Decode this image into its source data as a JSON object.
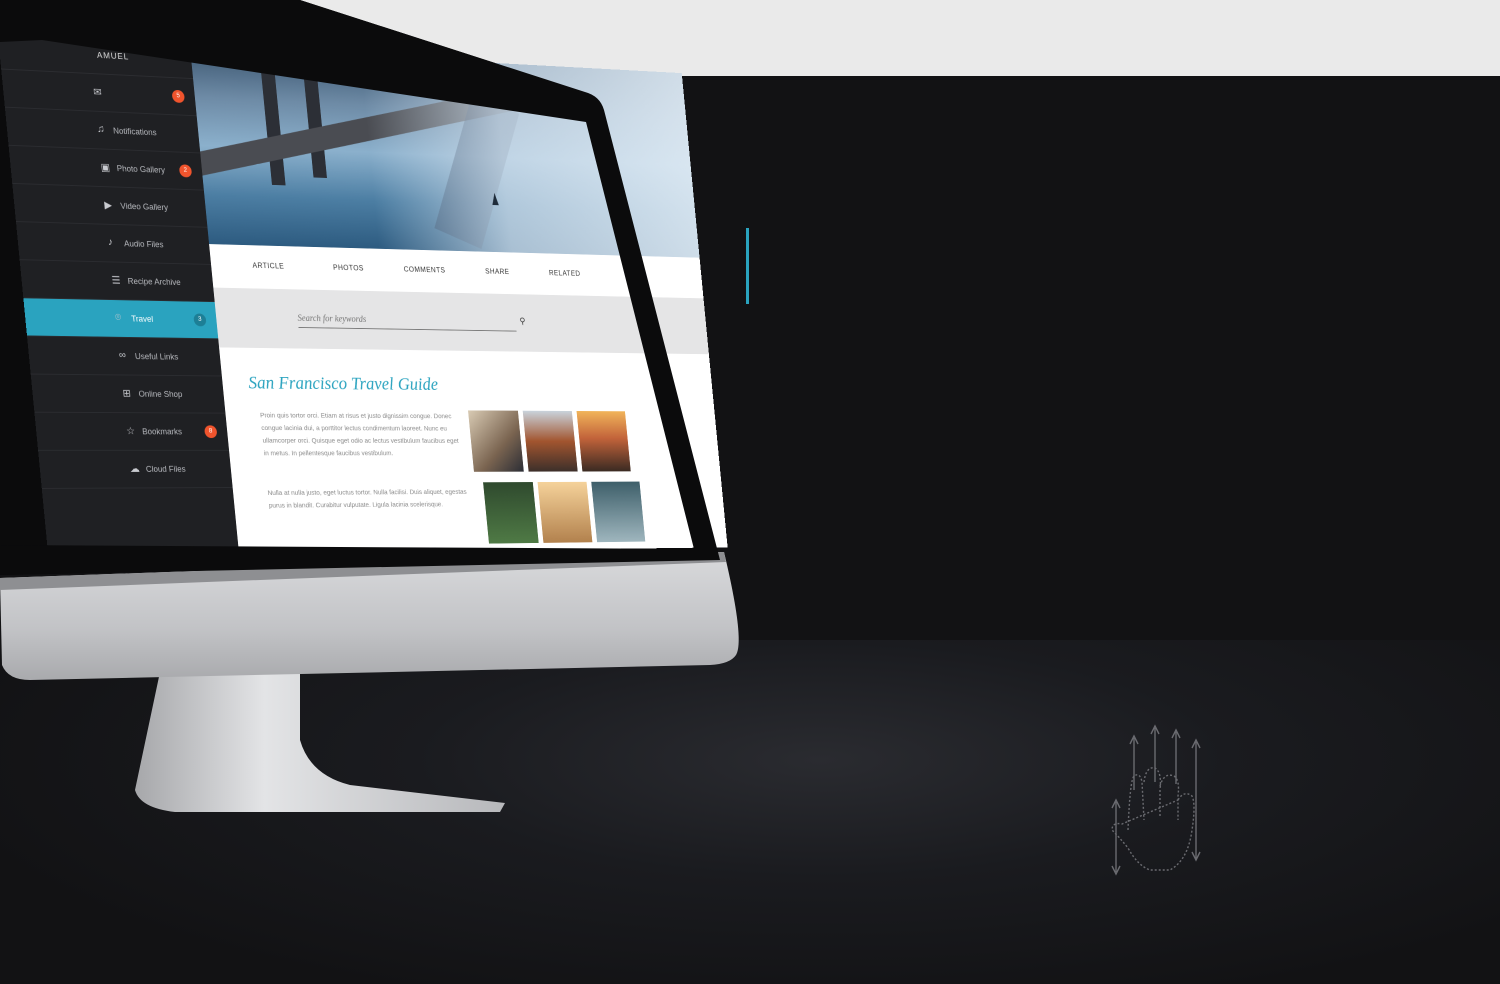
{
  "sidebar": {
    "user": "AMUEL",
    "items": [
      {
        "label": "",
        "icon": "inbox-icon",
        "badge": "5"
      },
      {
        "label": "Notifications",
        "icon": "bell-icon",
        "badge": ""
      },
      {
        "label": "Photo Gallery",
        "icon": "image-icon",
        "badge": "2"
      },
      {
        "label": "Video Gallery",
        "icon": "video-icon",
        "badge": ""
      },
      {
        "label": "Audio Files",
        "icon": "music-icon",
        "badge": ""
      },
      {
        "label": "Recipe Archive",
        "icon": "recipe-icon",
        "badge": ""
      },
      {
        "label": "Travel",
        "icon": "map-pin-icon",
        "badge": "3",
        "active": true
      },
      {
        "label": "Useful Links",
        "icon": "link-icon",
        "badge": ""
      },
      {
        "label": "Online Shop",
        "icon": "basket-icon",
        "badge": ""
      },
      {
        "label": "Bookmarks",
        "icon": "star-icon",
        "badge": "8"
      },
      {
        "label": "Cloud Files",
        "icon": "cloud-icon",
        "badge": ""
      }
    ]
  },
  "tabs": [
    "ARTICLE",
    "PHOTOS",
    "COMMENTS",
    "SHARE",
    "RELATED"
  ],
  "search": {
    "placeholder": "Search for keywords"
  },
  "article": {
    "title": "San Francisco Travel Guide",
    "paragraph_1": "Proin quis tortor orci. Etiam at risus et justo dignissim congue. Donec congue lacinia dui, a porttitor lectus condimentum laoreet. Nunc eu ullamcorper orci. Quisque eget odio ac lectus vestibulum faucibus eget in metus. In pellentesque faucibus vestibulum.",
    "paragraph_2": "Nulla at nulla justo, eget luctus tortor. Nulla facilisi. Duis aliquet, egestas purus in blandit. Curabitur vulputate. Ligula lacinia scelerisque."
  },
  "colors": {
    "accent": "#2aa3bf",
    "badge": "#f0542d",
    "sidebar": "#1f2023",
    "background": "#121214"
  }
}
